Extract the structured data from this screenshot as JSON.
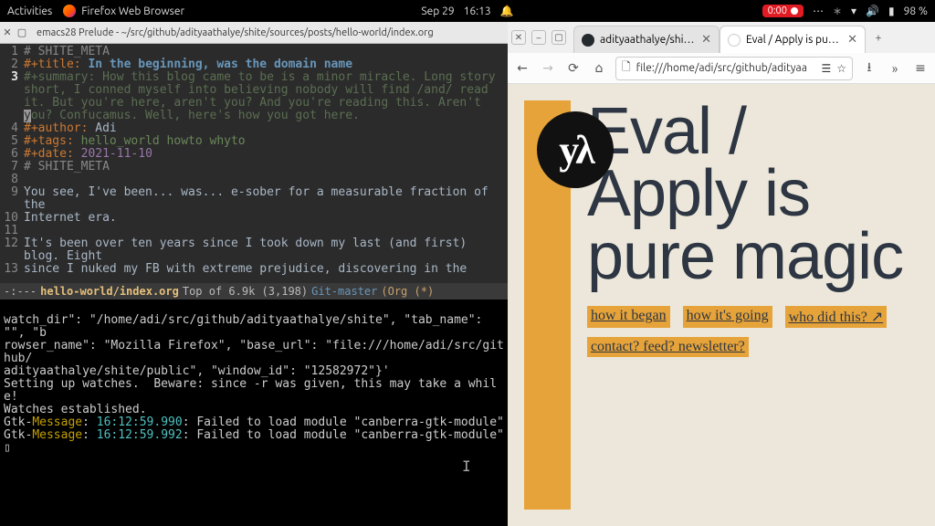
{
  "topbar": {
    "activities": "Activities",
    "app": "Firefox Web Browser",
    "date": "Sep 29",
    "time": "16:13",
    "rec": "0:00",
    "battery": "98 %"
  },
  "emacs": {
    "title": "emacs28 Prelude - ~/src/github/adityaathalye/shite/sources/posts/hello-world/index.org",
    "lines": {
      "l1": "# SHITE_META",
      "l2a": "#+title: ",
      "l2b": "In the beginning, was the domain name",
      "l3a": "#+summary: How this blog came to be is a minor miracle. Long story",
      "l3b": "short, I conned myself into believing nobody will find /and/ read",
      "l3c": "it. But you're here, aren't you? And you're reading this. Aren't",
      "l3d": "ou? Confucamus. Well, here's how you got here.",
      "l4a": "#+author: ",
      "l4b": "Adi",
      "l5a": "#+tags: ",
      "l5b": "hello_world howto whyto",
      "l6a": "#+date: ",
      "l6b": "2021-11-10",
      "l7": "# SHITE_META",
      "l9a": "You see, I've been... was... e-sober for a measurable fraction of",
      "l9b": "the",
      "l10": "Internet era.",
      "l12a": "It's been over ten years since I took down my last (and first)",
      "l12b": "blog. Eight",
      "l13": "since I nuked my FB with extreme prejudice, discovering in the"
    },
    "modeline": {
      "prefix": "-:---",
      "file": "hello-world/index.org",
      "pos": "Top of 6.9k (3,198)",
      "git": "Git-master",
      "mode": "(Org (*)"
    }
  },
  "term": {
    "l1": "watch_dir\": \"/home/adi/src/github/adityaathalye/shite\", \"tab_name\": \"\", \"b",
    "l2": "rowser_name\": \"Mozilla Firefox\", \"base_url\": \"file:///home/adi/src/github/",
    "l3": "adityaathalye/shite/public\", \"window_id\": \"12582972\"}'",
    "l4": "Setting up watches.  Beware: since -r was given, this may take a while!",
    "l5": "Watches established.",
    "msg": "Message",
    "gtk": "Gtk-",
    "ts1": "16:12:59.990",
    "ts2": "16:12:59.992",
    "err": ": Failed to load module \"canberra-gtk-module\""
  },
  "browser": {
    "tabs": [
      {
        "label": "adityaathalye/shite: The"
      },
      {
        "label": "Eval / Apply is pure magic"
      }
    ],
    "url": "file:///home/adi/src/github/adityaa",
    "page": {
      "logo_text": "yλ",
      "headline": "Eval / Apply is pure magic",
      "links": [
        "how it began",
        "how it's going",
        "who did this? ↗",
        "contact? feed? newsletter?"
      ]
    }
  }
}
